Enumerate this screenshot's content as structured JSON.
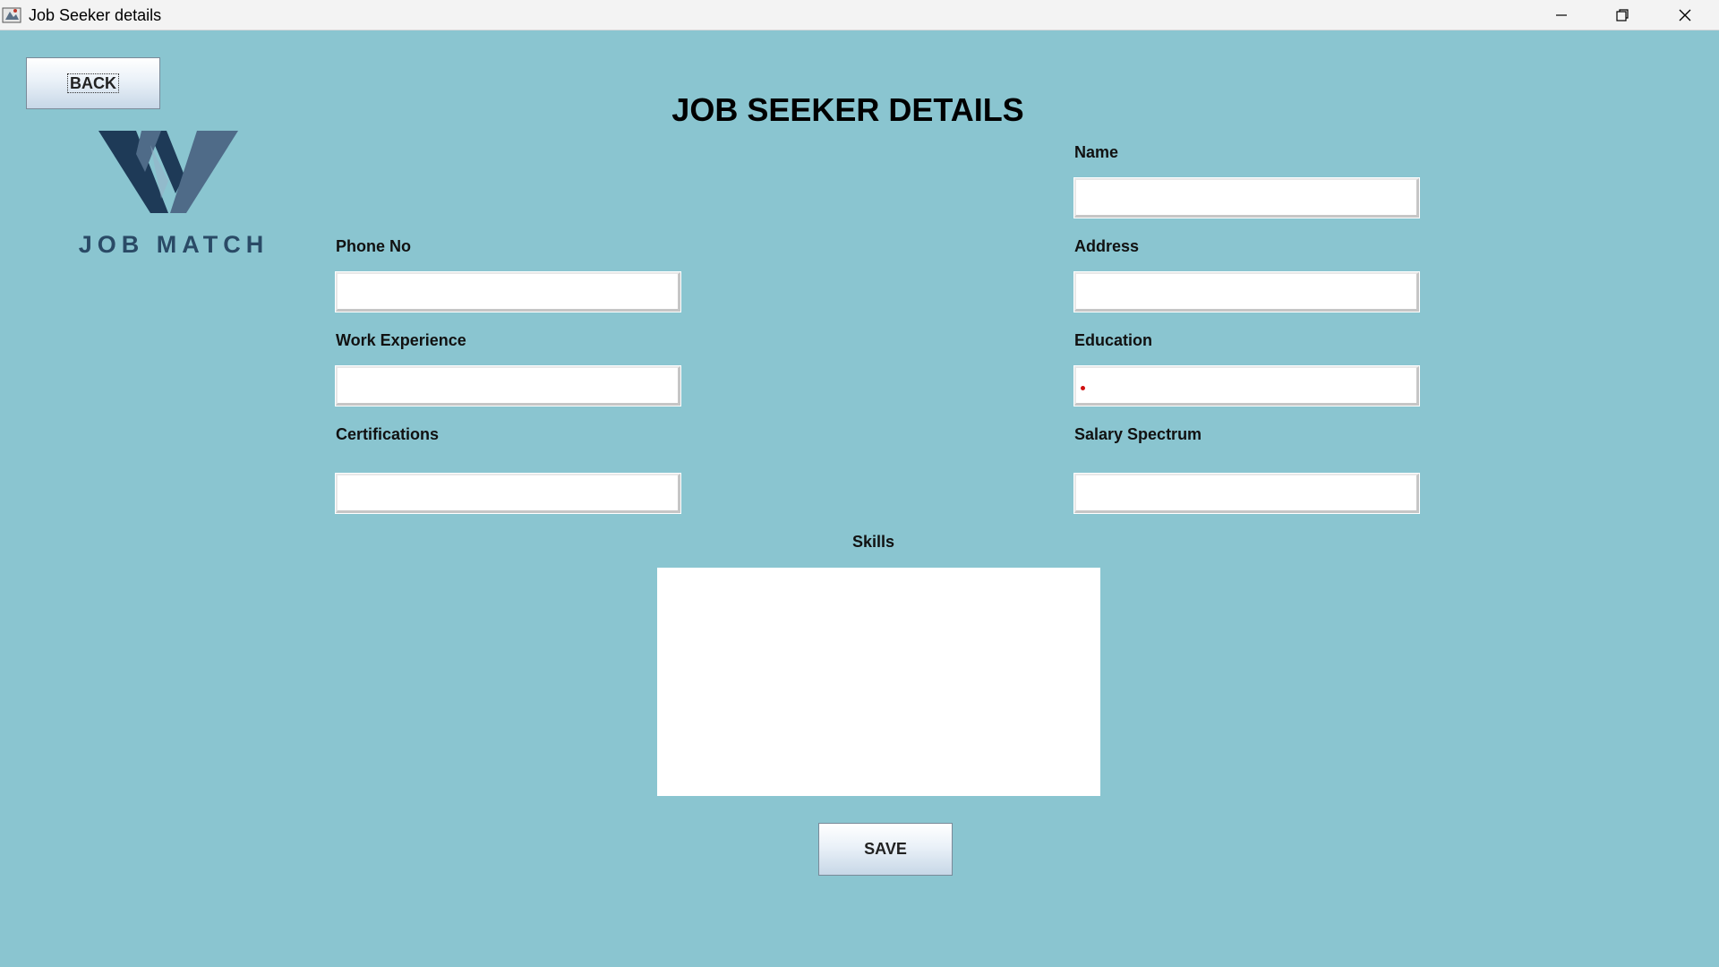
{
  "window": {
    "title": "Job Seeker details",
    "controls": [
      "minimize-icon",
      "restore-icon",
      "close-icon"
    ]
  },
  "back_button": {
    "label": "BACK"
  },
  "logo": {
    "text": "JOB MATCH",
    "icon": "w-logo-icon"
  },
  "page_title": "JOB SEEKER DETAILS",
  "form": {
    "name": {
      "label": "Name",
      "value": ""
    },
    "phone": {
      "label": "Phone No",
      "value": ""
    },
    "address": {
      "label": "Address",
      "value": ""
    },
    "work_experience": {
      "label": "Work Experience",
      "value": ""
    },
    "education": {
      "label": "Education",
      "value": ""
    },
    "certifications": {
      "label": "Certifications",
      "value": ""
    },
    "salary_spectrum": {
      "label": "Salary Spectrum",
      "value": ""
    },
    "skills": {
      "label": "Skills",
      "value": ""
    }
  },
  "save_button": {
    "label": "SAVE"
  },
  "colors": {
    "background": "#8ac5d0",
    "logo_dark": "#1e3a57",
    "logo_light": "#4f6b88",
    "caret": "#d01010"
  }
}
